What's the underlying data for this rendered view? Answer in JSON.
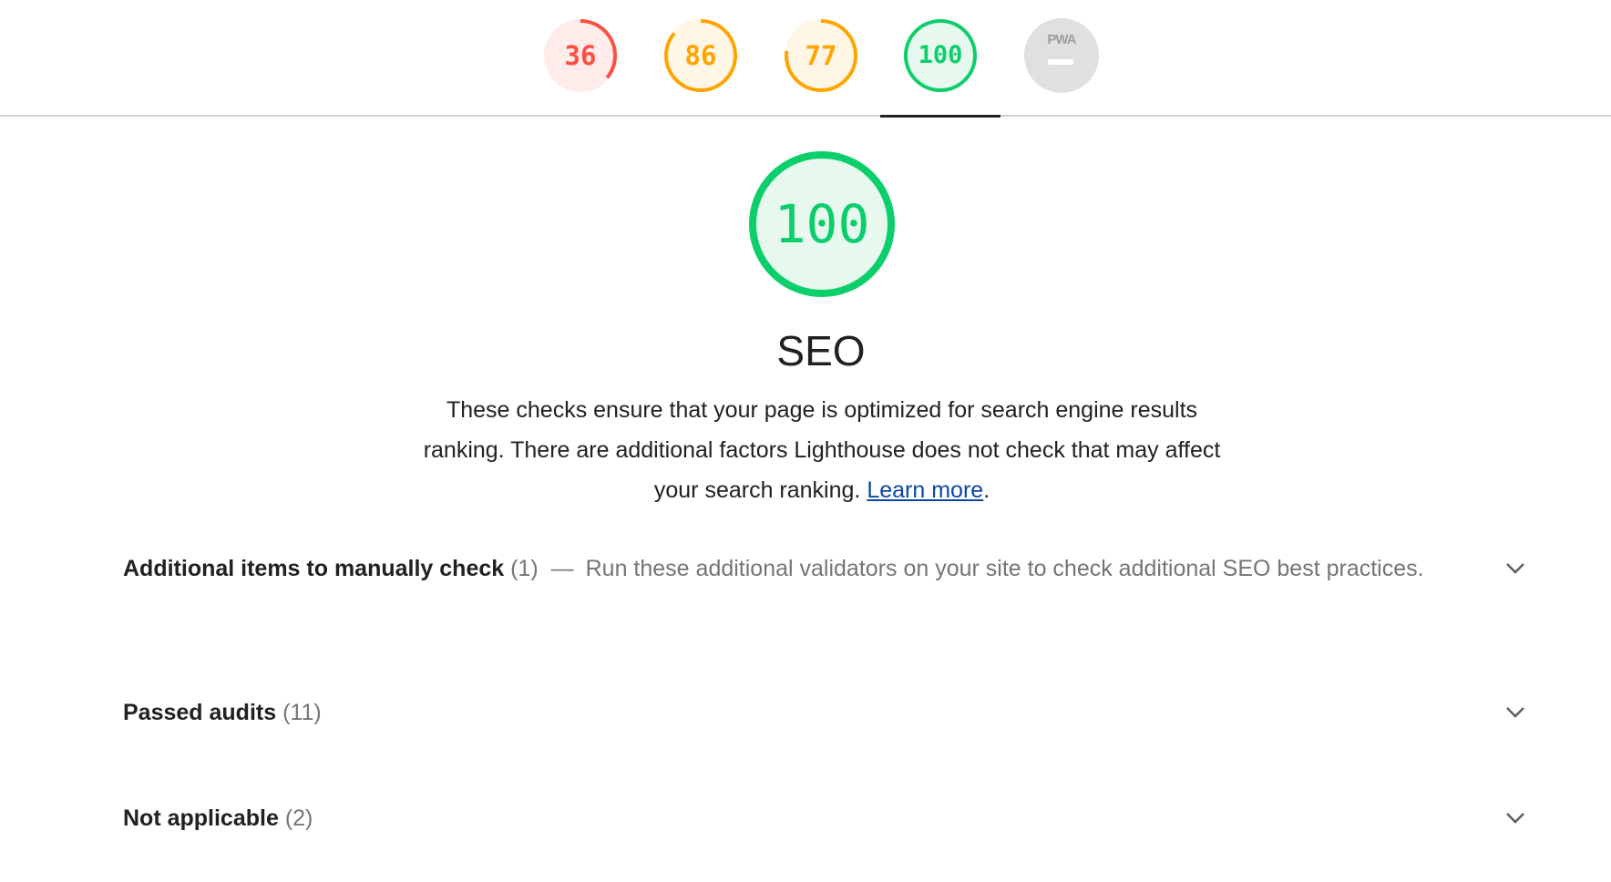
{
  "score_gauges": [
    {
      "score": "36",
      "fraction": 0.36,
      "color": "#ff4e42",
      "bg": "#ffeceb"
    },
    {
      "score": "86",
      "fraction": 0.86,
      "color": "#ffa400",
      "bg": "#fff6e6"
    },
    {
      "score": "77",
      "fraction": 0.77,
      "color": "#ffa400",
      "bg": "#fff6e6"
    },
    {
      "score": "100",
      "fraction": 1.0,
      "color": "#0cce6b",
      "bg": "#e7f9ef"
    }
  ],
  "pwa_badge": {
    "label": "PWA",
    "color": "#9e9e9e"
  },
  "active_category": {
    "score": "100",
    "fraction": 1.0,
    "color": "#0cce6b",
    "bg": "#e7f9ef",
    "title": "SEO",
    "description": "These checks ensure that your page is optimized for search engine results ranking. There are additional factors Lighthouse does not check that may affect your search ranking.",
    "learn_more": "Learn more",
    "trailing_period": "."
  },
  "audit_groups": [
    {
      "title": "Additional items to manually check",
      "count": "(1)",
      "separator": "—",
      "description": "Run these additional validators on your site to check additional SEO best practices.",
      "icon": "chevron-down-icon"
    },
    {
      "title": "Passed audits",
      "count": "(11)",
      "icon": "chevron-down-icon"
    },
    {
      "title": "Not applicable",
      "count": "(2)",
      "icon": "chevron-down-icon"
    }
  ]
}
